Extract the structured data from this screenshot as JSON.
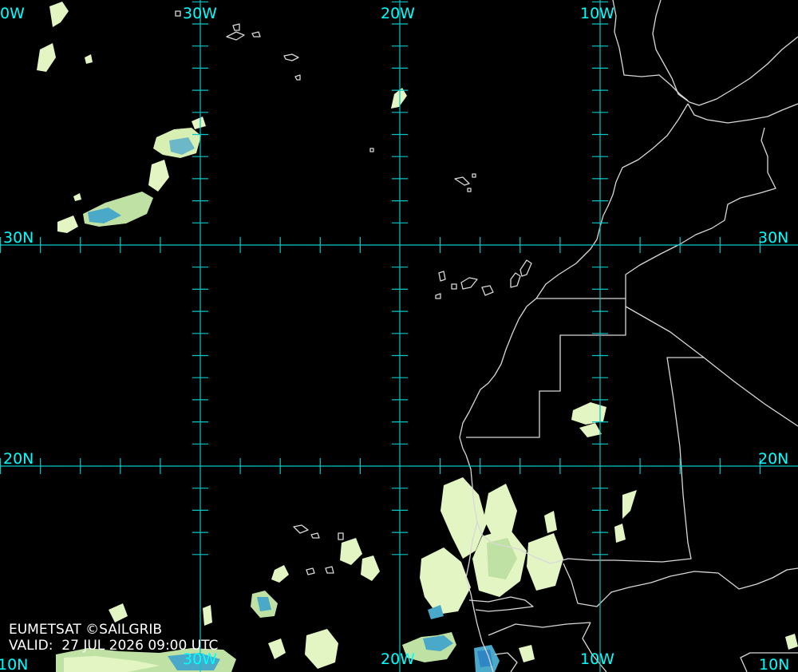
{
  "map": {
    "longitude_labels": [
      "30W",
      "20W",
      "10W"
    ],
    "latitude_labels": [
      "30N",
      "20N"
    ],
    "edge_labels": {
      "top_left": "0W",
      "bottom_left": "10N",
      "bottom_right": "10N"
    }
  },
  "credits": {
    "source": "EUMETSAT ©SAILGRIB",
    "valid": "VALID:  27 JUL 2026 09:00 UTC"
  },
  "colors": {
    "background": "#000000",
    "grid": "#00c8c8",
    "label": "#00ffff",
    "coastline": "#d8d8d8",
    "cloud_light": "#e4f5c4",
    "cloud_mid": "#bfe2a4",
    "cloud_deep": "#4aa8c8",
    "cloud_core": "#2f86c4"
  }
}
